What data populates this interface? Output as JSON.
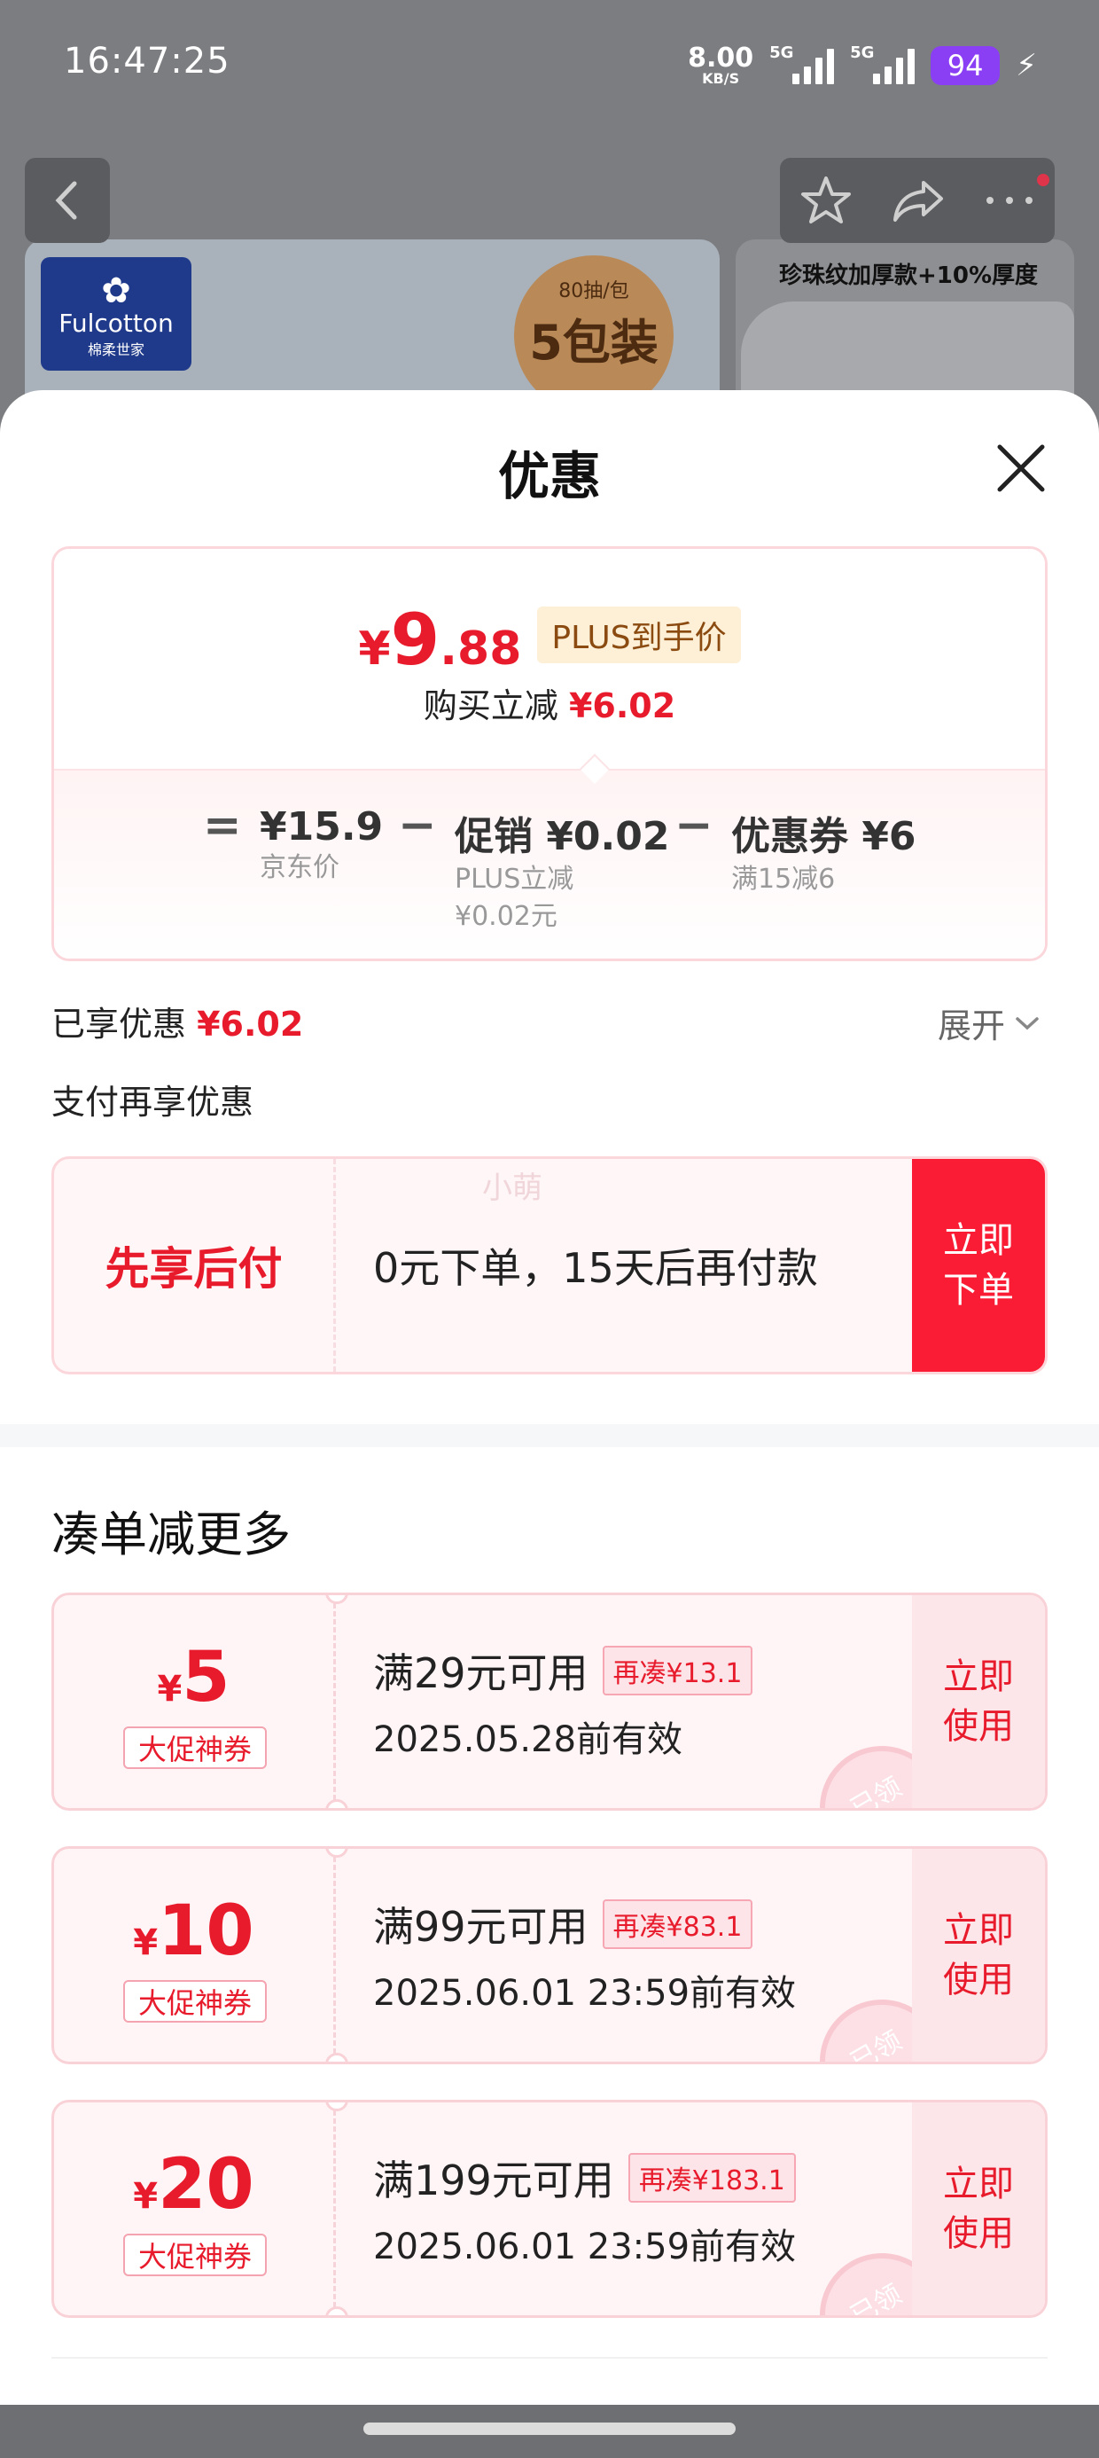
{
  "status_bar": {
    "time": "16:47:25",
    "speed_value": "8.00",
    "speed_unit": "KB/S",
    "net1": "5G",
    "net2": "5G",
    "battery": "94"
  },
  "product_bg": {
    "brand_en": "Fulcotton",
    "brand_cn": "棉柔世家",
    "badge_top": "80抽/包",
    "badge_main": "5包装",
    "side_caption": "珍珠纹加厚款+10%厚度"
  },
  "sheet": {
    "title": "优惠",
    "price": {
      "yen": "¥",
      "int": "9",
      "dec": ".88",
      "plus_tag": "PLUS到手价",
      "reduce_label": "购买立减",
      "reduce_value": "¥6.02"
    },
    "calc": {
      "eq": "=",
      "jd_price": "¥15.9",
      "jd_label": "京东价",
      "minus1": "−",
      "promo": "促销 ¥0.02",
      "promo_sub1": "PLUS立减",
      "promo_sub2": "¥0.02元",
      "minus2": "−",
      "coupon": "优惠券 ¥6",
      "coupon_sub": "满15减6"
    },
    "enjoyed_label": "已享优惠",
    "enjoyed_value": "¥6.02",
    "expand_label": "展开",
    "pay_more_label": "支付再享优惠",
    "pay_later": {
      "title": "先享后付",
      "desc": "0元下单，15天后再付款",
      "button": "立即\n下单",
      "watermark": "小萌"
    },
    "more_title": "凑单减更多",
    "coupons": [
      {
        "yen": "¥",
        "amount": "5",
        "tag": "大促神券",
        "cond": "满29元可用",
        "badge": "再凑¥13.1",
        "date": "2025.05.28前有效",
        "button": "立即\n使用",
        "stamp": "已领"
      },
      {
        "yen": "¥",
        "amount": "10",
        "tag": "大促神券",
        "cond": "满99元可用",
        "badge": "再凑¥83.1",
        "date": "2025.06.01 23:59前有效",
        "button": "立即\n使用",
        "stamp": "已领"
      },
      {
        "yen": "¥",
        "amount": "20",
        "tag": "大促神券",
        "cond": "满199元可用",
        "badge": "再凑¥183.1",
        "date": "2025.06.01 23:59前有效",
        "button": "立即\n使用",
        "stamp": "已领"
      }
    ]
  },
  "colors": {
    "accent_red": "#e81b2c",
    "button_red": "#fa1b34",
    "plus_tag_bg": "#fdf0d6",
    "battery_purple": "#8a3ff5"
  }
}
